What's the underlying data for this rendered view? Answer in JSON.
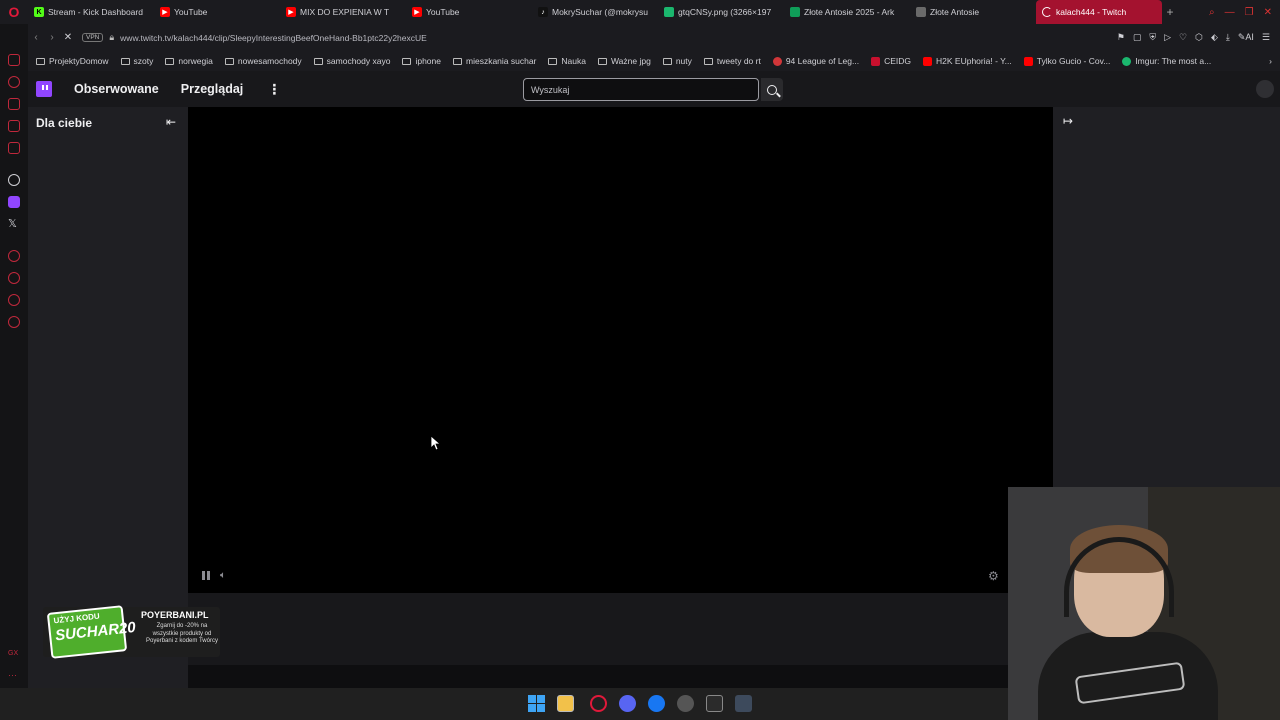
{
  "browser": {
    "tabs": [
      {
        "label": "Stream - Kick Dashboard",
        "icon": "kick-icon",
        "color": "#53fc18"
      },
      {
        "label": "YouTube",
        "icon": "youtube-icon",
        "color": "#ff0000"
      },
      {
        "label": "MIX DO EXPIENIA W T",
        "icon": "youtube-icon",
        "color": "#ff0000"
      },
      {
        "label": "YouTube",
        "icon": "youtube-icon",
        "color": "#ff0000"
      },
      {
        "label": "MokrySuchar (@mokrysu",
        "icon": "tiktok-icon",
        "color": "#ffffff"
      },
      {
        "label": "gtqCNSy.png (3266×197",
        "icon": "image-icon",
        "color": "#1bb76e"
      },
      {
        "label": "Złote Antosie 2025 - Ark",
        "icon": "sheets-icon",
        "color": "#0f9d58"
      },
      {
        "label": "Złote Antosie",
        "icon": "page-icon",
        "color": "#6a6a6a"
      },
      {
        "label": "kalach444 - Twitch",
        "icon": "loading-icon",
        "color": "#e0193a",
        "active": true
      }
    ],
    "url": "www.twitch.tv/kalach444/clip/SleepyInterestingBeefOneHand-Bb1ptc22y2hexcUE",
    "vpn_label": "VPN",
    "bookmarks": [
      {
        "label": "ProjektyDomow",
        "type": "folder"
      },
      {
        "label": "szoty",
        "type": "folder"
      },
      {
        "label": "norwegia",
        "type": "folder"
      },
      {
        "label": "nowesamochody",
        "type": "folder"
      },
      {
        "label": "samochody xayo",
        "type": "folder"
      },
      {
        "label": "iphone",
        "type": "folder"
      },
      {
        "label": "mieszkania suchar",
        "type": "folder"
      },
      {
        "label": "Nauka",
        "type": "folder"
      },
      {
        "label": "Ważne jpg",
        "type": "folder"
      },
      {
        "label": "nuty",
        "type": "folder"
      },
      {
        "label": "tweety do rt",
        "type": "folder"
      },
      {
        "label": "94 League of Leg...",
        "type": "site",
        "color": "#d13639"
      },
      {
        "label": "CEIDG",
        "type": "site",
        "color": "#c8102e"
      },
      {
        "label": "H2K EUphoria! - Y...",
        "type": "site",
        "color": "#ff0000"
      },
      {
        "label": "Tylko Gucio - Cov...",
        "type": "site",
        "color": "#ff0000"
      },
      {
        "label": "Imgur: The most a...",
        "type": "site",
        "color": "#1bb76e"
      }
    ]
  },
  "twitch": {
    "nav": {
      "following": "Obserwowane",
      "browse": "Przeglądaj",
      "more": "⋮"
    },
    "search": {
      "placeholder": "Wyszukaj"
    },
    "left_column": {
      "title": "Dla ciebie",
      "collapse": "⇤"
    },
    "right_column": {
      "expand": "↦"
    }
  },
  "promo": {
    "code_top": "UŻYJ KODU",
    "code": "SUCHAR20",
    "brand": "POYERBANI.PL",
    "subtitle": "Zgarnij do -20% na wszystkie produkty od Poyerbani z kodem Twórcy"
  },
  "colors": {
    "twitch_purple": "#9146ff",
    "opera_red": "#e0193a",
    "active_tab": "#a4122f"
  }
}
